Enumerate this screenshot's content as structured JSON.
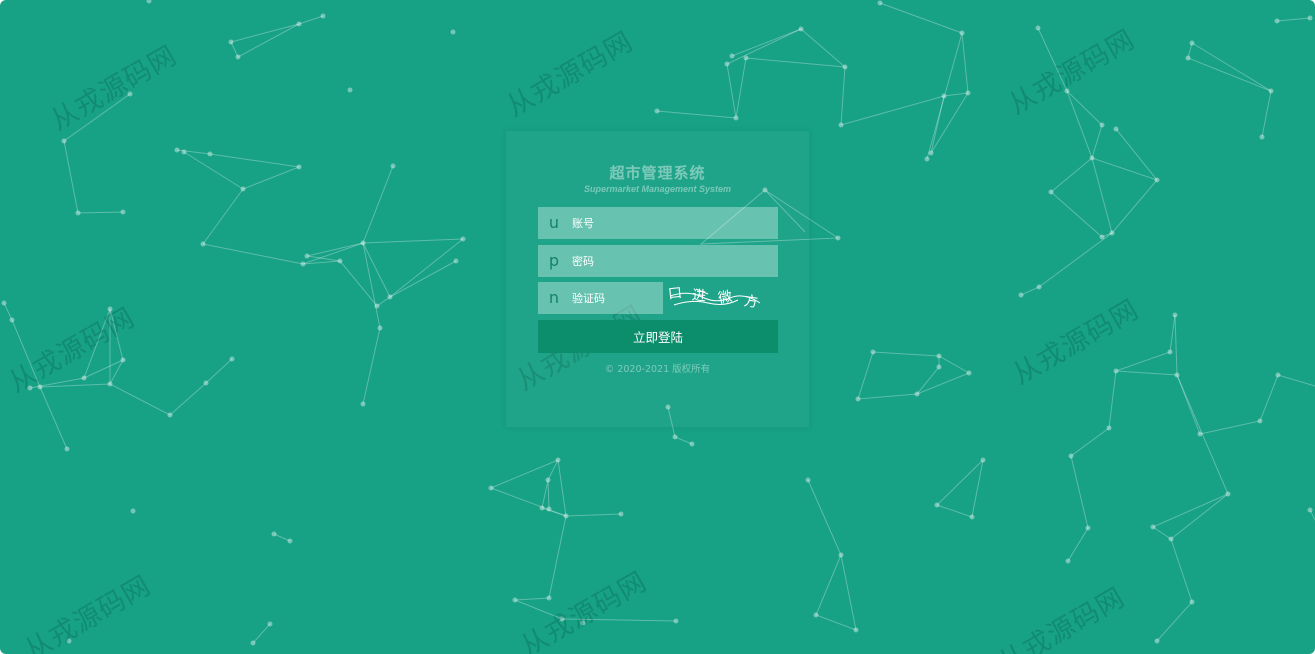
{
  "login": {
    "title": "超市管理系统",
    "subtitle": "Supermarket Management System",
    "username": {
      "icon": "user-icon",
      "letter": "u",
      "placeholder": "账号",
      "value": ""
    },
    "password": {
      "icon": "lock-icon",
      "letter": "p",
      "placeholder": "密码",
      "value": ""
    },
    "captcha": {
      "icon": "shield-icon",
      "letter": "n",
      "placeholder": "验证码",
      "value": "",
      "image_text": "口 进 微 方"
    },
    "submit_label": "立即登陆",
    "copyright": "© 2020-2021 版权所有"
  },
  "watermark": {
    "text": "从戎源码网"
  },
  "theme": {
    "background": "#17a185",
    "button": "#0c8d6c",
    "icon_color": "#14836c"
  }
}
